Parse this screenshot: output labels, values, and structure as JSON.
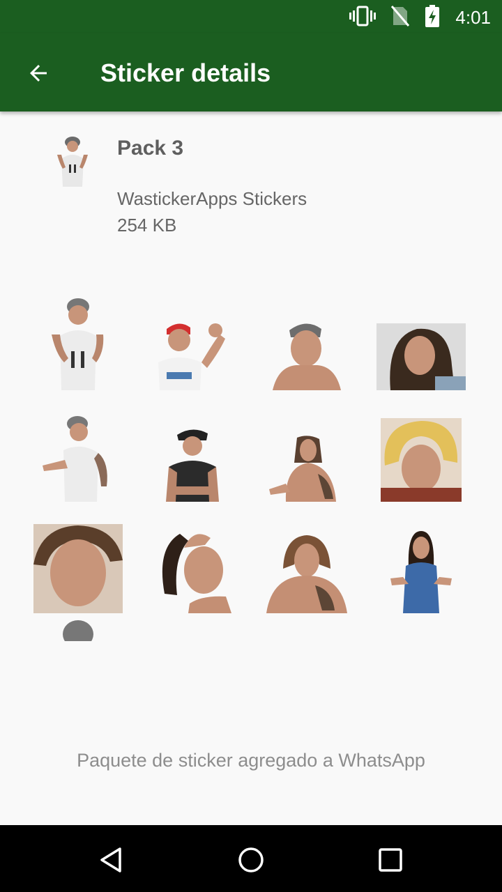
{
  "status_bar": {
    "time": "4:01",
    "icons": [
      "vibrate-icon",
      "no-sim-icon",
      "battery-charging-icon"
    ]
  },
  "app_bar": {
    "title": "Sticker details",
    "back_icon": "arrow-back-icon"
  },
  "pack": {
    "name": "Pack 3",
    "publisher": "WastickerApps Stickers",
    "size": "254 KB"
  },
  "stickers": [
    {
      "name": "sticker-1"
    },
    {
      "name": "sticker-2"
    },
    {
      "name": "sticker-3"
    },
    {
      "name": "sticker-4"
    },
    {
      "name": "sticker-5"
    },
    {
      "name": "sticker-6"
    },
    {
      "name": "sticker-7"
    },
    {
      "name": "sticker-8"
    },
    {
      "name": "sticker-9"
    },
    {
      "name": "sticker-10"
    },
    {
      "name": "sticker-11"
    },
    {
      "name": "sticker-12"
    },
    {
      "name": "sticker-13"
    }
  ],
  "message": "Paquete de sticker agregado a WhatsApp",
  "nav": [
    "back-triangle-icon",
    "home-circle-icon",
    "recents-square-icon"
  ],
  "colors": {
    "app_bar": "#1b5e20",
    "background": "#f9f9f9",
    "skin": "#c8957a",
    "hair": "#3a2a1e"
  }
}
